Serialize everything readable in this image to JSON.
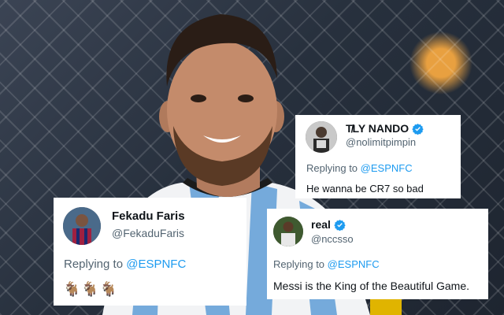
{
  "tweets": [
    {
      "display_name": "T̸LY NANDO",
      "handle": "@nolimitpimpin",
      "verified": true,
      "replying_label": "Replying to",
      "replying_to": "@ESPNFC",
      "text": "He wanna be CR7 so bad",
      "avatar_icon": "user-avatar"
    },
    {
      "display_name": "Fekadu Faris",
      "handle": "@FekaduFaris",
      "verified": false,
      "replying_label": "Replying to",
      "replying_to": "@ESPNFC",
      "text": "🐐🐐🐐",
      "avatar_icon": "user-avatar"
    },
    {
      "display_name": "real",
      "handle": "@nccsso",
      "verified": true,
      "replying_label": "Replying to",
      "replying_to": "@ESPNFC",
      "text": "Messi is the King of the Beautiful Game.",
      "avatar_icon": "user-avatar"
    }
  ],
  "colors": {
    "card_bg": "#ffffff",
    "name": "#0f1419",
    "secondary": "#536471",
    "mention": "#1d9bf0",
    "verified_badge": "#1d9bf0",
    "argentina_blue": "#75aadb"
  }
}
